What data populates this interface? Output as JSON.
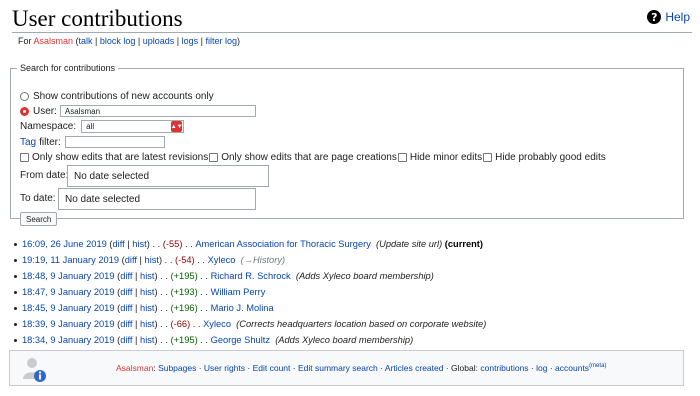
{
  "header": {
    "title": "User contributions",
    "help_label": "Help"
  },
  "subtitle": {
    "for_label": "For",
    "username": "Asalsman",
    "talk": "talk",
    "block_log": "block log",
    "uploads": "uploads",
    "logs": "logs",
    "filter_log": "filter log"
  },
  "search": {
    "legend": "Search for contributions",
    "new_accounts_label": "Show contributions of new accounts only",
    "user_label": "User:",
    "user_value": "Asalsman",
    "namespace_label": "Namespace:",
    "namespace_value": "all",
    "tag_link": "Tag",
    "tag_filter_label": "filter:",
    "checkboxes": [
      "Only show edits that are latest revisions",
      "Only show edits that are page creations",
      "Hide minor edits",
      "Hide probably good edits"
    ],
    "from_date_label": "From date:",
    "from_date_value": "No date selected",
    "to_date_label": "To date:",
    "to_date_value": "No date selected",
    "search_button": "Search"
  },
  "contributions": [
    {
      "time": "16:09, 26 June 2019",
      "diff": "diff",
      "hist": "hist",
      "size": "(-55)",
      "size_sign": "neg",
      "page": "American Association for Thoracic Surgery",
      "summary": "(Update site url)",
      "current": "(current)"
    },
    {
      "time": "19:19, 11 January 2019",
      "diff": "diff",
      "hist": "hist",
      "size": "(-54)",
      "size_sign": "neg",
      "page": "Xyleco",
      "summary": "(→History)",
      "current": ""
    },
    {
      "time": "18:48, 9 January 2019",
      "diff": "diff",
      "hist": "hist",
      "size": "(+195)",
      "size_sign": "pos",
      "page": "Richard R. Schrock",
      "summary": "(Adds Xyleco board membership)",
      "current": ""
    },
    {
      "time": "18:47, 9 January 2019",
      "diff": "diff",
      "hist": "hist",
      "size": "(+193)",
      "size_sign": "pos",
      "page": "William Perry",
      "summary": "",
      "current": ""
    },
    {
      "time": "18:45, 9 January 2019",
      "diff": "diff",
      "hist": "hist",
      "size": "(+196)",
      "size_sign": "pos",
      "page": "Mario J. Molina",
      "summary": "",
      "current": ""
    },
    {
      "time": "18:39, 9 January 2019",
      "diff": "diff",
      "hist": "hist",
      "size": "(-66)",
      "size_sign": "neg",
      "page": "Xyleco",
      "summary": "(Corrects headquarters location based on corporate website)",
      "current": ""
    },
    {
      "time": "18:34, 9 January 2019",
      "diff": "diff",
      "hist": "hist",
      "size": "(+195)",
      "size_sign": "pos",
      "page": "George Shultz",
      "summary": "(Adds Xyleco board membership)",
      "current": ""
    }
  ],
  "footer": {
    "username": "Asalsman",
    "subpages": "Subpages",
    "user_rights": "User rights",
    "edit_count": "Edit count",
    "edit_summary_search": "Edit summary search",
    "articles_created": "Articles created",
    "global_label": "Global:",
    "contributions": "contributions",
    "log": "log",
    "accounts": "accounts",
    "meta": "(meta)"
  },
  "colors": {
    "link": "#0645ad",
    "redlink": "#d33",
    "positive": "#006400",
    "negative": "#8b0000"
  },
  "icons": [
    "help-icon",
    "user-info-icon"
  ]
}
